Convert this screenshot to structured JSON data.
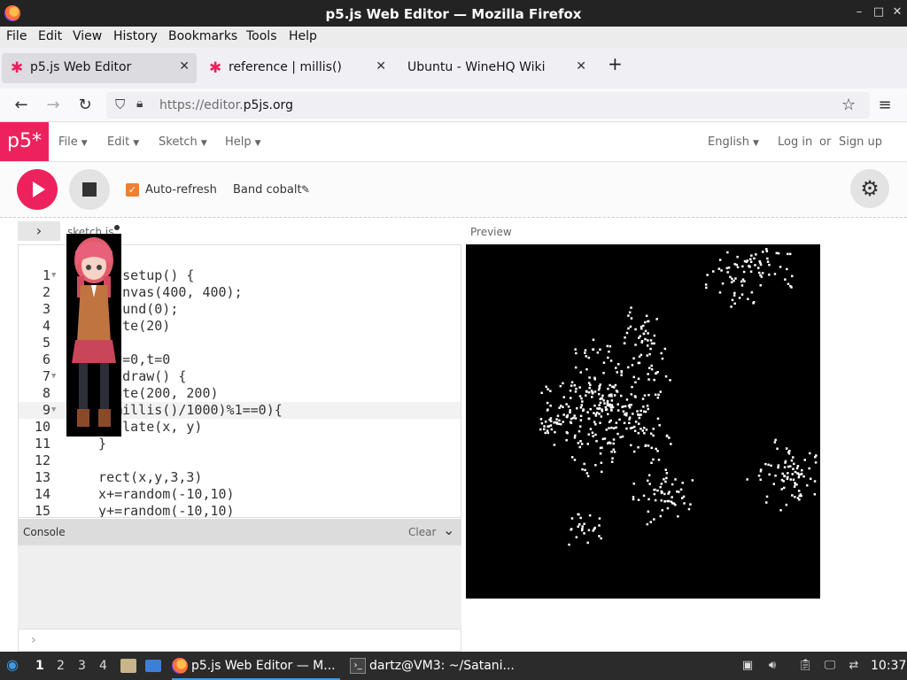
{
  "window": {
    "title": "p5.js Web Editor — Mozilla Firefox",
    "controls": [
      "–",
      "□",
      "✕"
    ]
  },
  "menubar": [
    "File",
    "Edit",
    "View",
    "History",
    "Bookmarks",
    "Tools",
    "Help"
  ],
  "tabs": [
    {
      "label": "p5.js Web Editor",
      "active": true,
      "icon": "p5-favicon-icon"
    },
    {
      "label": "reference | millis()",
      "active": false,
      "icon": "p5-favicon-icon"
    },
    {
      "label": "Ubuntu - WineHQ Wiki",
      "active": false,
      "icon": "none"
    }
  ],
  "url": {
    "prefix": "https://editor.",
    "domain": "p5js.org"
  },
  "p5nav": {
    "logo": "p5*",
    "menus": [
      "File",
      "Edit",
      "Sketch",
      "Help"
    ],
    "language": "English",
    "login": "Log in",
    "or": "or",
    "signup": "Sign up"
  },
  "toolbar": {
    "auto_refresh": "Auto-refresh",
    "sketch_name": "Band cobalt",
    "auto_refresh_checked": true
  },
  "editor": {
    "file_name": "sketch.js",
    "lines": [
      {
        "n": "1",
        "code": "   n setup() {",
        "fold": true
      },
      {
        "n": "2",
        "code": "  eCanvas(400, 400);",
        "fold": false
      },
      {
        "n": "3",
        "code": "   round(0);",
        "fold": false
      },
      {
        "n": "4",
        "code": "   Rate(20)",
        "fold": false
      },
      {
        "n": "5",
        "code": "",
        "fold": false
      },
      {
        "n": "6",
        "code": "   ,y=0,t=0",
        "fold": false
      },
      {
        "n": "7",
        "code": "   n draw() {",
        "fold": true
      },
      {
        "n": "8",
        "code": "   late(200, 200)",
        "fold": false
      },
      {
        "n": "9",
        "code": "   (millis()/1000)%1==0){",
        "fold": true,
        "highlight": true
      },
      {
        "n": "10",
        "code": "   nslate(x, y)",
        "fold": false
      },
      {
        "n": "11",
        "code": "  }",
        "fold": false
      },
      {
        "n": "12",
        "code": "",
        "fold": false
      },
      {
        "n": "13",
        "code": "  rect(x,y,3,3)",
        "fold": false
      },
      {
        "n": "14",
        "code": "  x+=random(-10,10)",
        "fold": false
      },
      {
        "n": "15",
        "code": "  y+=random(-10,10)",
        "fold": false
      }
    ]
  },
  "console": {
    "title": "Console",
    "clear": "Clear",
    "prompt": "›"
  },
  "preview": {
    "label": "Preview"
  },
  "taskbar": {
    "workspaces": [
      "1",
      "2",
      "3",
      "4"
    ],
    "tasks": [
      {
        "label": "p5.js Web Editor — M...",
        "active": true
      },
      {
        "label": "dartz@VM3: ~/Satani...",
        "active": false
      }
    ],
    "clock": "10:37"
  }
}
